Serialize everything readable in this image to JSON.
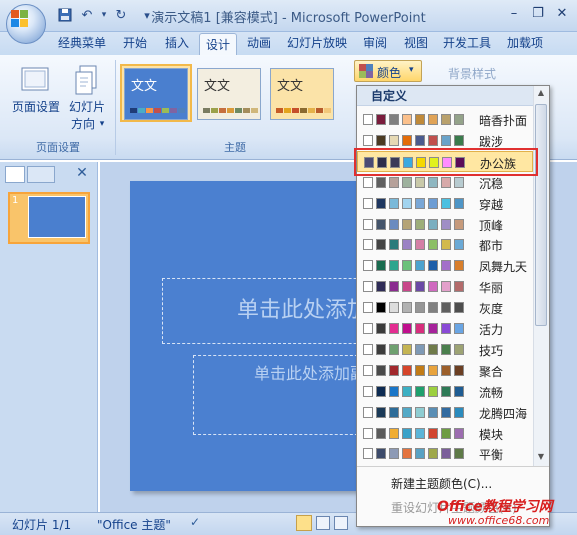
{
  "window": {
    "title": "演示文稿1 [兼容模式] - Microsoft PowerPoint",
    "controls": [
      "–",
      "❐",
      "✕"
    ]
  },
  "quick_access": [
    "save",
    "undo",
    "redo"
  ],
  "tabs": [
    "经典菜单",
    "开始",
    "插入",
    "设计",
    "动画",
    "幻灯片放映",
    "审阅",
    "视图",
    "开发工具",
    "加载项"
  ],
  "active_tab": "设计",
  "ribbon": {
    "page_setup": {
      "page_setup_label": "页面设置",
      "orientation_label_line1": "幻灯片",
      "orientation_label_line2": "方向",
      "orientation_arrow": "▾",
      "group_label": "页面设置"
    },
    "themes": {
      "group_label": "主题",
      "thumbs": [
        {
          "text": "文文",
          "bg": "#4a7fcf",
          "fg": "#ffffff",
          "colors": [
            "#1f3c78",
            "#4bacc6",
            "#f79646",
            "#c0504d",
            "#9bbb59",
            "#8064a2",
            "#4f81bd"
          ]
        },
        {
          "text": "文文",
          "bg": "#f3eee0",
          "fg": "#333333",
          "colors": [
            "#7b7c61",
            "#9ba14a",
            "#c66f3e",
            "#d99a3a",
            "#6e8a62",
            "#a48d5b",
            "#d0b77a"
          ]
        },
        {
          "text": "文文",
          "bg": "#fbe3a8",
          "fg": "#333333",
          "colors": [
            "#c65b26",
            "#e3a31d",
            "#c64f2a",
            "#8b6a2f",
            "#e5b24a",
            "#b85b2b",
            "#f2c77a"
          ]
        }
      ]
    },
    "colors_button": "颜色",
    "colors_arrow": "▾",
    "background_style": "背景样式"
  },
  "colors_dropdown": {
    "header": "自定义",
    "items": [
      {
        "name": "暗香扑面",
        "colors": [
          "#ffffff",
          "#7a1c3c",
          "#7f7f7f",
          "#fbc08b",
          "#c08a3a",
          "#e0a357",
          "#b9a16c",
          "#94a38a"
        ]
      },
      {
        "name": "跋涉",
        "colors": [
          "#ffffff",
          "#4a3a23",
          "#e6d9b4",
          "#e36c09",
          "#4a5b8e",
          "#c0504d",
          "#6aa3c9",
          "#3a7b4c"
        ]
      },
      {
        "name": "办公族",
        "colors": [
          "#4b4b74",
          "#2c2c4a",
          "#3a3a58",
          "#3aa9e0",
          "#f5d800",
          "#e1f11d",
          "#ff8cff",
          "#5b0c58"
        ]
      },
      {
        "name": "沉稳",
        "colors": [
          "#ffffff",
          "#5f5f5f",
          "#b6a19a",
          "#9eb29e",
          "#c9c9a9",
          "#8fb7c1",
          "#d7a9a9",
          "#b7cbd0"
        ]
      },
      {
        "name": "穿越",
        "colors": [
          "#ffffff",
          "#1f3760",
          "#7ab9d9",
          "#a2d4ef",
          "#7aa7d6",
          "#6d9dd4",
          "#4cc0e0",
          "#4e95c6"
        ]
      },
      {
        "name": "顶峰",
        "colors": [
          "#ffffff",
          "#44546a",
          "#6a8bbf",
          "#b4a376",
          "#9dae7a",
          "#7aaec0",
          "#9f8ec5",
          "#c69a7b"
        ]
      },
      {
        "name": "都市",
        "colors": [
          "#ffffff",
          "#444444",
          "#2a7b7b",
          "#9b82c4",
          "#d47fa6",
          "#8dbf66",
          "#d2b94d",
          "#6aa9d6"
        ]
      },
      {
        "name": "凤舞九天",
        "colors": [
          "#ffffff",
          "#1a6b4f",
          "#2ca58e",
          "#6cc17b",
          "#4da3cf",
          "#1e5ea8",
          "#a36fc9",
          "#d87e2a"
        ]
      },
      {
        "name": "华丽",
        "colors": [
          "#ffffff",
          "#2f2c57",
          "#8a2c8f",
          "#c8478a",
          "#6b4aa5",
          "#cf6abf",
          "#e3a0cb",
          "#b36b6b"
        ]
      },
      {
        "name": "灰度",
        "colors": [
          "#ffffff",
          "#000000",
          "#dddddd",
          "#b2b2b2",
          "#969696",
          "#808080",
          "#5f5f5f",
          "#4d4d4d"
        ]
      },
      {
        "name": "活力",
        "colors": [
          "#ffffff",
          "#3b3b3b",
          "#e32d91",
          "#c00f8d",
          "#d82e7d",
          "#a6229b",
          "#8a4ad6",
          "#6aa5e3"
        ]
      },
      {
        "name": "技巧",
        "colors": [
          "#ffffff",
          "#3c3c3c",
          "#6ea06f",
          "#c4b452",
          "#7f9ab6",
          "#6f7b4a",
          "#4b7f4d",
          "#9da374"
        ]
      },
      {
        "name": "聚合",
        "colors": [
          "#ffffff",
          "#4a4a4a",
          "#a1282c",
          "#d6452a",
          "#c27b16",
          "#e8a33d",
          "#9c5f2a",
          "#6b3f23"
        ]
      },
      {
        "name": "流畅",
        "colors": [
          "#ffffff",
          "#0e2b52",
          "#1a76c8",
          "#3db0c3",
          "#1fa06d",
          "#9ccf3f",
          "#2e7a56",
          "#1f5c92"
        ]
      },
      {
        "name": "龙腾四海",
        "colors": [
          "#ffffff",
          "#1b3a57",
          "#2d6c98",
          "#53a9c6",
          "#8fcdd2",
          "#5a8eb4",
          "#326ba0",
          "#2b8bbd"
        ]
      },
      {
        "name": "模块",
        "colors": [
          "#ffffff",
          "#5a5a5a",
          "#f0ad32",
          "#3aa2c9",
          "#5bb5d8",
          "#d2452e",
          "#6e9d42",
          "#9c6cb0"
        ]
      },
      {
        "name": "平衡",
        "colors": [
          "#ffffff",
          "#3d4b6a",
          "#8d9ab5",
          "#e3733f",
          "#58a2c4",
          "#9fa84a",
          "#7b5e9a",
          "#5e7a47"
        ]
      }
    ],
    "new_colors": "新建主题颜色(C)...",
    "reset_colors": "重设幻灯片主题颜色(R)"
  },
  "slide": {
    "title_placeholder": "单击此处添加标题",
    "subtitle_placeholder": "单击此处添加副标题",
    "thumb_number": "1"
  },
  "status": {
    "slide_count": "幻灯片 1/1",
    "theme_name": "\"Office 主题\""
  },
  "watermark": {
    "line1": "Office教程学习网",
    "line2": "www.office68.com"
  }
}
